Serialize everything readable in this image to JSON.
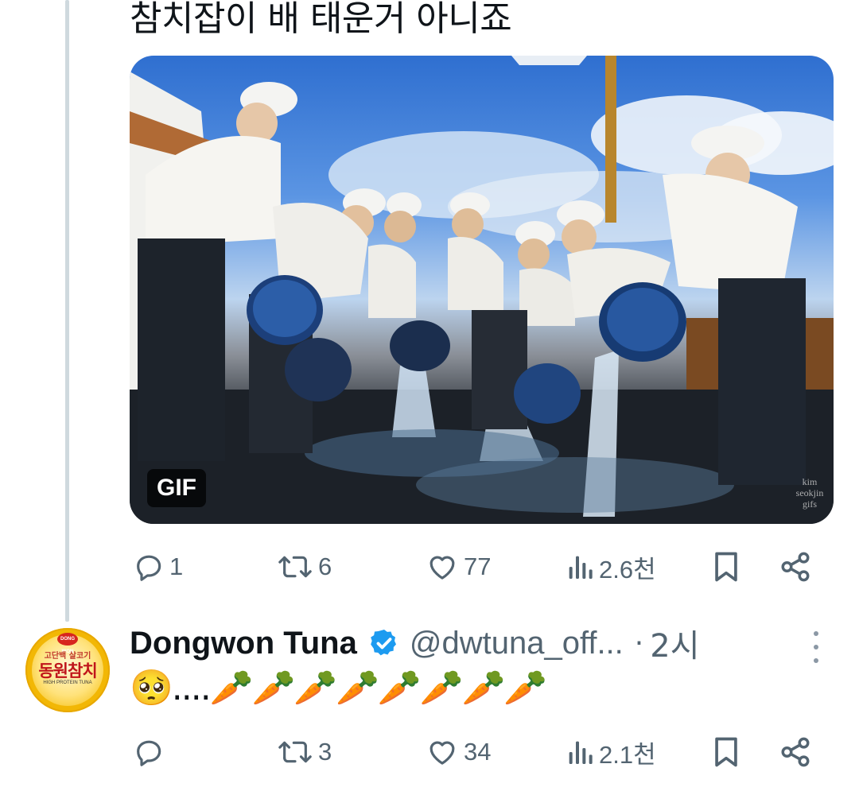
{
  "tweet": {
    "text": "참치잡이 배 태운거 아니죠",
    "media": {
      "badge": "GIF",
      "watermark": "kim seokjin gifs"
    },
    "actions": {
      "replies": "1",
      "retweets": "6",
      "likes": "77",
      "views": "2.6천"
    }
  },
  "reply": {
    "avatar": {
      "logo": "DONG WON",
      "subtitle": "고단백 살코기",
      "brand": "동원참치",
      "tagline": "HIGH PROTEIN TUNA"
    },
    "display_name": "Dongwon Tuna",
    "handle": "@dwtuna_off...",
    "separator": "·",
    "time": "2시",
    "text": "🥺....🥕🥕🥕🥕🥕🥕🥕🥕",
    "actions": {
      "replies": "",
      "retweets": "3",
      "likes": "34",
      "views": "2.1천"
    }
  },
  "colors": {
    "text_primary": "#0f1419",
    "text_secondary": "#536471",
    "thread_line": "#cfd9de",
    "verified": "#1d9bf0"
  },
  "icons": [
    "reply-icon",
    "retweet-icon",
    "like-icon",
    "views-icon",
    "bookmark-icon",
    "share-icon",
    "verified-icon",
    "more-icon"
  ]
}
